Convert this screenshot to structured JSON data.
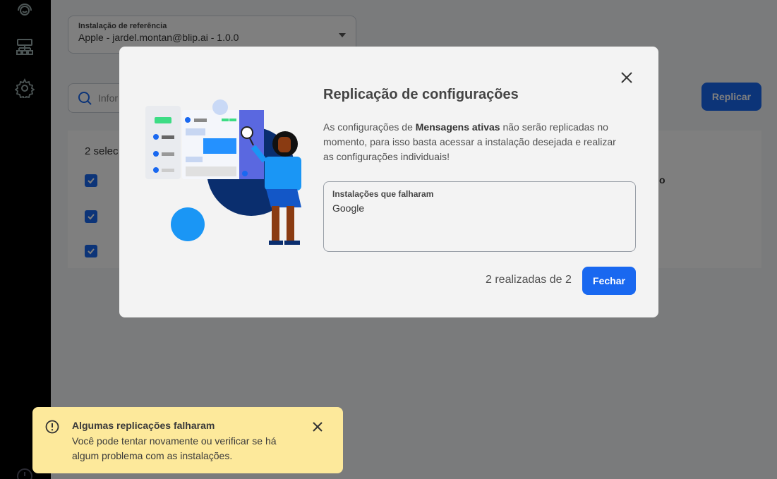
{
  "background": {
    "reference_select": {
      "label": "Instalação de referência",
      "value": "Apple - jardel.montan@blip.ai - 1.0.0"
    },
    "search": {
      "placeholder": "Infor"
    },
    "replicate_button": "Replicar",
    "table": {
      "selected_count": "2 selec",
      "column_tail": "o"
    }
  },
  "modal": {
    "title": "Replicação de configurações",
    "description_prefix": "As configurações de ",
    "description_bold": "Mensagens ativas",
    "description_suffix": " não serão replicadas no momento, para isso basta acessar a instalação desejada e realizar as configurações individuais!",
    "failed_label": "Instalações que falharam",
    "failed_value": "Google",
    "progress": "2 realizadas de 2",
    "close_button": "Fechar"
  },
  "toast": {
    "title": "Algumas replicações falharam",
    "message": "Você pode tentar novamente ou verificar se há algum problema com as instalações."
  },
  "colors": {
    "primary": "#1968f0",
    "toast_bg": "#fde99b",
    "sidebar": "#000000"
  }
}
